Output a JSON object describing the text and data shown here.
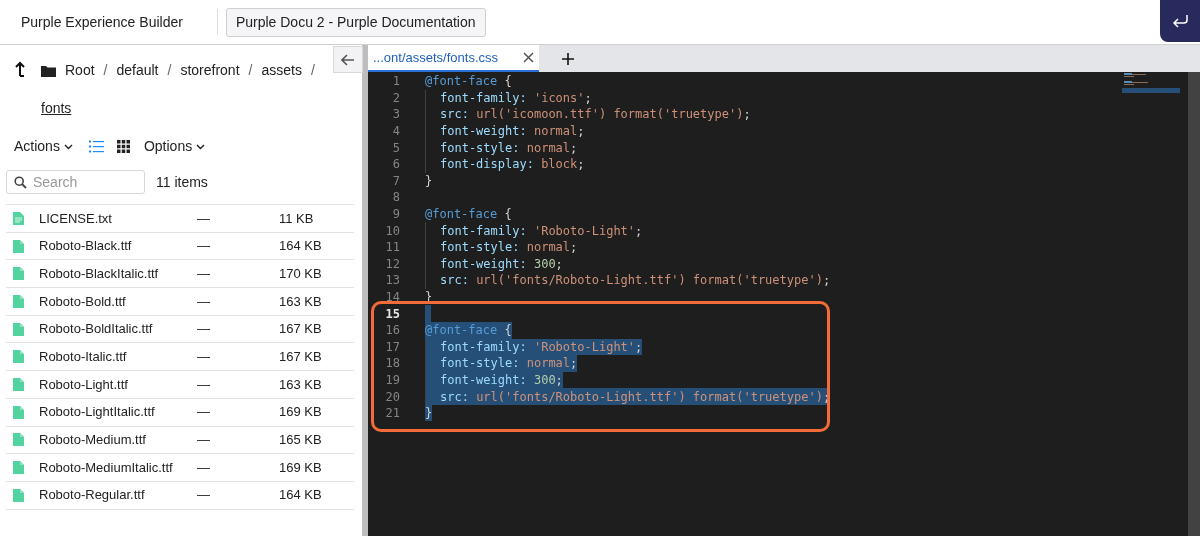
{
  "header": {
    "app_title": "Purple Experience Builder",
    "project_button": "Purple Docu 2 - Purple Documentation"
  },
  "breadcrumb": [
    {
      "label": "Root",
      "current": false
    },
    {
      "label": "default",
      "current": false
    },
    {
      "label": "storefront",
      "current": false
    },
    {
      "label": "assets",
      "current": false
    },
    {
      "label": "fonts",
      "current": true
    }
  ],
  "breadcrumb_separator": "/",
  "toolbar": {
    "actions": "Actions",
    "view_modes": [
      {
        "kind": "list",
        "selected": true
      },
      {
        "kind": "grid",
        "selected": false
      }
    ],
    "options": "Options"
  },
  "search": {
    "placeholder": "Search"
  },
  "item_count": "11 items",
  "files": [
    {
      "kind": "text",
      "name": "LICENSE.txt",
      "modified": "—",
      "size": "11 KB"
    },
    {
      "kind": "file",
      "name": "Roboto-Black.ttf",
      "modified": "—",
      "size": "164 KB"
    },
    {
      "kind": "file",
      "name": "Roboto-BlackItalic.ttf",
      "modified": "—",
      "size": "170 KB"
    },
    {
      "kind": "file",
      "name": "Roboto-Bold.ttf",
      "modified": "—",
      "size": "163 KB"
    },
    {
      "kind": "file",
      "name": "Roboto-BoldItalic.ttf",
      "modified": "—",
      "size": "167 KB"
    },
    {
      "kind": "file",
      "name": "Roboto-Italic.ttf",
      "modified": "—",
      "size": "167 KB"
    },
    {
      "kind": "file",
      "name": "Roboto-Light.ttf",
      "modified": "—",
      "size": "163 KB"
    },
    {
      "kind": "file",
      "name": "Roboto-LightItalic.ttf",
      "modified": "—",
      "size": "169 KB"
    },
    {
      "kind": "file",
      "name": "Roboto-Medium.ttf",
      "modified": "—",
      "size": "165 KB"
    },
    {
      "kind": "file",
      "name": "Roboto-MediumItalic.ttf",
      "modified": "—",
      "size": "169 KB"
    },
    {
      "kind": "file",
      "name": "Roboto-Regular.ttf",
      "modified": "—",
      "size": "164 KB"
    }
  ],
  "editor": {
    "tabs": [
      {
        "label": "...ont/assets/fonts.css",
        "selected": true
      }
    ],
    "lines": [
      {
        "number": "1",
        "indented": false,
        "selected": false,
        "current": false,
        "tokens": [
          {
            "kind": "at",
            "text": "@font-face"
          },
          {
            "kind": "punct",
            "text": " {"
          }
        ]
      },
      {
        "number": "2",
        "indented": true,
        "selected": false,
        "current": false,
        "tokens": [
          {
            "kind": "prop",
            "text": "font-family:"
          },
          {
            "kind": "str",
            "text": " 'icons'"
          },
          {
            "kind": "punct",
            "text": ";"
          }
        ]
      },
      {
        "number": "3",
        "indented": true,
        "selected": false,
        "current": false,
        "tokens": [
          {
            "kind": "prop",
            "text": "src:"
          },
          {
            "kind": "str",
            "text": " url('icomoon.ttf') format('truetype')"
          },
          {
            "kind": "punct",
            "text": ";"
          }
        ]
      },
      {
        "number": "4",
        "indented": true,
        "selected": false,
        "current": false,
        "tokens": [
          {
            "kind": "prop",
            "text": "font-weight:"
          },
          {
            "kind": "str",
            "text": " normal"
          },
          {
            "kind": "punct",
            "text": ";"
          }
        ]
      },
      {
        "number": "5",
        "indented": true,
        "selected": false,
        "current": false,
        "tokens": [
          {
            "kind": "prop",
            "text": "font-style:"
          },
          {
            "kind": "str",
            "text": " normal"
          },
          {
            "kind": "punct",
            "text": ";"
          }
        ]
      },
      {
        "number": "6",
        "indented": true,
        "selected": false,
        "current": false,
        "tokens": [
          {
            "kind": "prop",
            "text": "font-display:"
          },
          {
            "kind": "str",
            "text": " block"
          },
          {
            "kind": "punct",
            "text": ";"
          }
        ]
      },
      {
        "number": "7",
        "indented": false,
        "selected": false,
        "current": false,
        "tokens": [
          {
            "kind": "punct",
            "text": "}"
          }
        ]
      },
      {
        "number": "8",
        "indented": false,
        "selected": false,
        "current": false
      },
      {
        "number": "9",
        "indented": false,
        "selected": false,
        "current": false,
        "tokens": [
          {
            "kind": "at",
            "text": "@font-face"
          },
          {
            "kind": "punct",
            "text": " {"
          }
        ]
      },
      {
        "number": "10",
        "indented": true,
        "selected": false,
        "current": false,
        "tokens": [
          {
            "kind": "prop",
            "text": "font-family:"
          },
          {
            "kind": "str",
            "text": " 'Roboto-Light'"
          },
          {
            "kind": "punct",
            "text": ";"
          }
        ]
      },
      {
        "number": "11",
        "indented": true,
        "selected": false,
        "current": false,
        "tokens": [
          {
            "kind": "prop",
            "text": "font-style:"
          },
          {
            "kind": "str",
            "text": " normal"
          },
          {
            "kind": "punct",
            "text": ";"
          }
        ]
      },
      {
        "number": "12",
        "indented": true,
        "selected": false,
        "current": false,
        "tokens": [
          {
            "kind": "prop",
            "text": "font-weight:"
          },
          {
            "kind": "num",
            "text": " 300"
          },
          {
            "kind": "punct",
            "text": ";"
          }
        ]
      },
      {
        "number": "13",
        "indented": true,
        "selected": false,
        "current": false,
        "tokens": [
          {
            "kind": "prop",
            "text": "src:"
          },
          {
            "kind": "str",
            "text": " url('fonts/Roboto-Light.ttf') format('truetype')"
          },
          {
            "kind": "punct",
            "text": ";"
          }
        ]
      },
      {
        "number": "14",
        "indented": false,
        "selected": false,
        "current": false,
        "tokens": [
          {
            "kind": "punct",
            "text": "}"
          }
        ]
      },
      {
        "number": "15",
        "indented": false,
        "selected": true,
        "current": true
      },
      {
        "number": "16",
        "indented": false,
        "selected": true,
        "current": false,
        "tokens": [
          {
            "kind": "at",
            "text": "@font-face"
          },
          {
            "kind": "punct",
            "text": " {"
          }
        ]
      },
      {
        "number": "17",
        "indented": true,
        "selected": true,
        "current": false,
        "tokens": [
          {
            "kind": "prop",
            "text": "font-family:"
          },
          {
            "kind": "str",
            "text": " 'Roboto-Light'"
          },
          {
            "kind": "punct",
            "text": ";"
          }
        ]
      },
      {
        "number": "18",
        "indented": true,
        "selected": true,
        "current": false,
        "tokens": [
          {
            "kind": "prop",
            "text": "font-style:"
          },
          {
            "kind": "str",
            "text": " normal"
          },
          {
            "kind": "punct",
            "text": ";"
          }
        ]
      },
      {
        "number": "19",
        "indented": true,
        "selected": true,
        "current": false,
        "tokens": [
          {
            "kind": "prop",
            "text": "font-weight:"
          },
          {
            "kind": "num",
            "text": " 300"
          },
          {
            "kind": "punct",
            "text": ";"
          }
        ]
      },
      {
        "number": "20",
        "indented": true,
        "selected": true,
        "current": false,
        "tokens": [
          {
            "kind": "prop",
            "text": "src:"
          },
          {
            "kind": "str",
            "text": " url('fonts/Roboto-Light.ttf') format('truetype')"
          },
          {
            "kind": "punct",
            "text": ";"
          }
        ]
      },
      {
        "number": "21",
        "indented": false,
        "selected": true,
        "current": false,
        "tokens": [
          {
            "kind": "punct",
            "text": "}"
          }
        ]
      }
    ]
  }
}
